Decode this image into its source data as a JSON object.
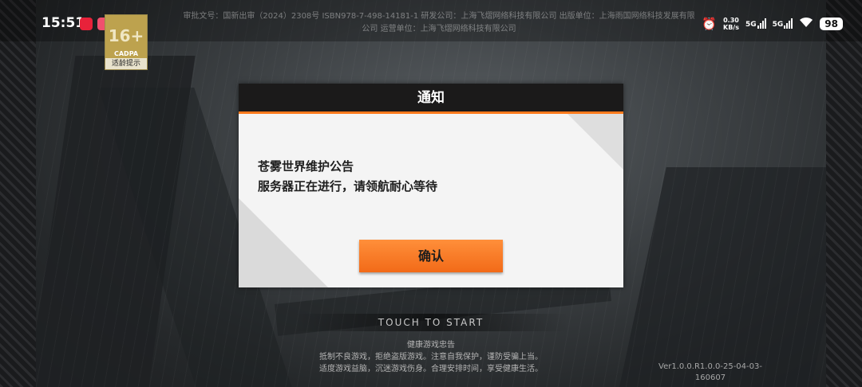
{
  "status_bar": {
    "time": "15:51",
    "net_speed_value": "0.30",
    "net_speed_unit": "KB/s",
    "sim1": "5G",
    "sim2": "5G",
    "battery": "98"
  },
  "legal_notice": {
    "line1": "审批文号：国新出审（2024）2308号  ISBN978-7-498-14181-1 研发公司：上海飞熠网络科技有限公司  出版单位：上海雨国网络科技发展有限",
    "line2": "公司  运营单位：上海飞熠网络科技有限公司"
  },
  "age_rating": {
    "age": "16+",
    "org": "CADPA",
    "label": "适龄提示"
  },
  "dialog": {
    "title": "通知",
    "message_line1": "苍雾世界维护公告",
    "message_line2": "服务器正在进行，请领航耐心等待",
    "confirm_label": "确认"
  },
  "screen": {
    "touch_prompt": "TOUCH TO START",
    "health_title": "健康游戏忠告",
    "health_line1": "抵制不良游戏，拒绝盗版游戏。注意自我保护，谨防受骗上当。",
    "health_line2": "适度游戏益脑，沉迷游戏伤身。合理安排时间，享受健康生活。",
    "version_line1": "Ver1.0.0.R1.0.0-25-04-03-",
    "version_line2": "160607"
  },
  "colors": {
    "accent": "#f26a18",
    "dialog_header": "#1b1a1a"
  }
}
